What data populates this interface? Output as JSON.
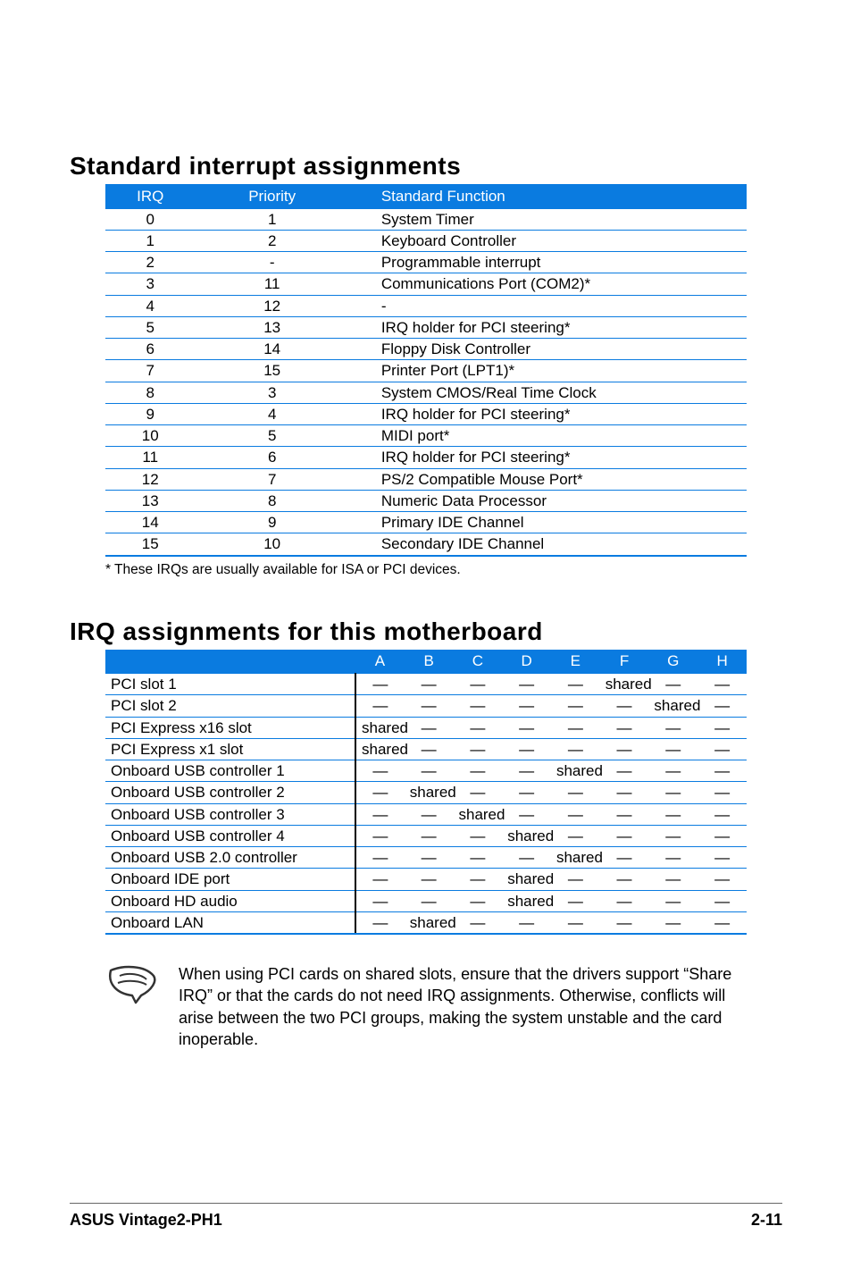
{
  "headings": {
    "section1": "Standard interrupt assignments",
    "section2": "IRQ assignments for this motherboard"
  },
  "irq_table": {
    "headers": {
      "irq": "IRQ",
      "priority": "Priority",
      "func": "Standard Function"
    },
    "rows": [
      {
        "irq": "0",
        "pri": "1",
        "func": "System Timer"
      },
      {
        "irq": "1",
        "pri": "2",
        "func": "Keyboard Controller"
      },
      {
        "irq": "2",
        "pri": "-",
        "func": "Programmable interrupt"
      },
      {
        "irq": "3",
        "pri": "11",
        "func": "Communications Port (COM2)*"
      },
      {
        "irq": "4",
        "pri": "12",
        "func": "-"
      },
      {
        "irq": "5",
        "pri": "13",
        "func": "IRQ holder for PCI steering*"
      },
      {
        "irq": "6",
        "pri": "14",
        "func": "Floppy Disk Controller"
      },
      {
        "irq": "7",
        "pri": "15",
        "func": "Printer Port (LPT1)*"
      },
      {
        "irq": "8",
        "pri": "3",
        "func": "System CMOS/Real Time Clock"
      },
      {
        "irq": "9",
        "pri": "4",
        "func": "IRQ holder for PCI steering*"
      },
      {
        "irq": "10",
        "pri": "5",
        "func": "MIDI port*"
      },
      {
        "irq": "11",
        "pri": "6",
        "func": "IRQ holder for PCI steering*"
      },
      {
        "irq": "12",
        "pri": "7",
        "func": "PS/2 Compatible Mouse Port*"
      },
      {
        "irq": "13",
        "pri": "8",
        "func": "Numeric Data Processor"
      },
      {
        "irq": "14",
        "pri": "9",
        "func": "Primary IDE Channel"
      },
      {
        "irq": "15",
        "pri": "10",
        "func": "Secondary IDE Channel"
      }
    ]
  },
  "footnote": "* These IRQs are usually available for ISA or PCI devices.",
  "assign_table": {
    "headers": [
      "A",
      "B",
      "C",
      "D",
      "E",
      "F",
      "G",
      "H"
    ],
    "rows": [
      {
        "name": "PCI slot 1",
        "cells": [
          "—",
          "—",
          "—",
          "—",
          "—",
          "shared",
          "—",
          "—"
        ]
      },
      {
        "name": "PCI slot 2",
        "cells": [
          "—",
          "—",
          "—",
          "—",
          "—",
          "—",
          "shared",
          "—"
        ]
      },
      {
        "name": "PCI Express x16 slot",
        "cells": [
          "shared",
          "—",
          "—",
          "—",
          "—",
          "—",
          "—",
          "—"
        ]
      },
      {
        "name": "PCI Express x1 slot",
        "cells": [
          "shared",
          "—",
          "—",
          "—",
          "—",
          "—",
          "—",
          "—"
        ]
      },
      {
        "name": "Onboard USB controller 1",
        "cells": [
          "—",
          "—",
          "—",
          "—",
          "shared",
          "—",
          "—",
          "—"
        ]
      },
      {
        "name": "Onboard USB controller 2",
        "cells": [
          "—",
          "shared",
          "—",
          "—",
          "—",
          "—",
          "—",
          "—"
        ]
      },
      {
        "name": "Onboard USB controller 3",
        "cells": [
          "—",
          "—",
          "shared",
          "—",
          "—",
          "—",
          "—",
          "—"
        ]
      },
      {
        "name": "Onboard USB controller 4",
        "cells": [
          "—",
          "—",
          "—",
          "shared",
          "—",
          "—",
          "—",
          "—"
        ]
      },
      {
        "name": "Onboard USB 2.0 controller",
        "cells": [
          "—",
          "—",
          "—",
          "—",
          "shared",
          "—",
          "—",
          "—"
        ]
      },
      {
        "name": "Onboard IDE port",
        "cells": [
          "—",
          "—",
          "—",
          "shared",
          "—",
          "—",
          "—",
          "—"
        ]
      },
      {
        "name": "Onboard HD audio",
        "cells": [
          "—",
          "—",
          "—",
          "shared",
          "—",
          "—",
          "—",
          "—"
        ]
      },
      {
        "name": "Onboard LAN",
        "cells": [
          "—",
          "shared",
          "—",
          "—",
          "—",
          "—",
          "—",
          "—"
        ]
      }
    ]
  },
  "note": "When using PCI cards on shared slots, ensure that the drivers support “Share IRQ” or that the cards do not need IRQ assignments. Otherwise, conflicts will arise between the two PCI groups, making the system unstable and the card inoperable.",
  "footer": {
    "left": "ASUS Vintage2-PH1",
    "right": "2-11"
  }
}
